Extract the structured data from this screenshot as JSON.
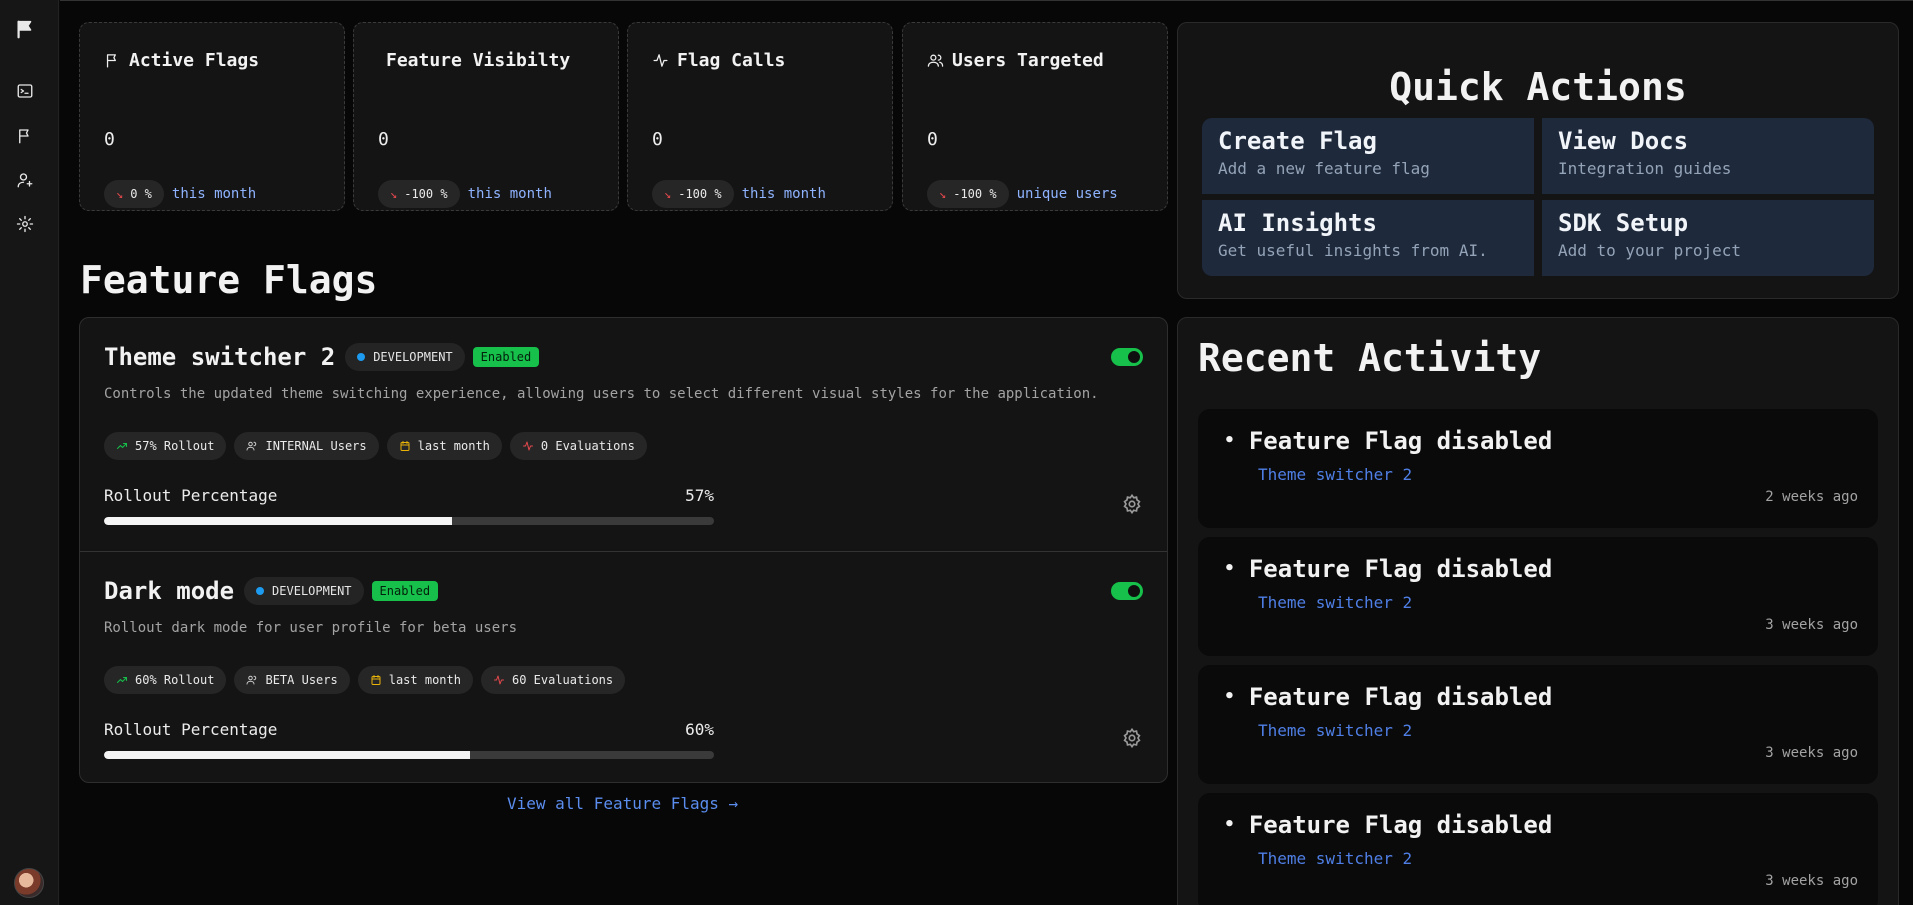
{
  "stats": [
    {
      "title": "Active Flags",
      "icon": "flag-icon",
      "value": "0",
      "change": "0 %",
      "sub": "this month"
    },
    {
      "title": "Feature Visibilty",
      "icon": "",
      "value": "0",
      "change": "-100 %",
      "sub": "this month"
    },
    {
      "title": "Flag Calls",
      "icon": "activity-icon",
      "value": "0",
      "change": "-100 %",
      "sub": "this month"
    },
    {
      "title": "Users Targeted",
      "icon": "users-icon",
      "value": "0",
      "change": "-100 %",
      "sub": "unique users"
    }
  ],
  "quick_actions": {
    "title": "Quick Actions",
    "items": [
      {
        "title": "Create Flag",
        "desc": "Add a new feature flag"
      },
      {
        "title": "View Docs",
        "desc": "Integration guides"
      },
      {
        "title": "AI Insights",
        "desc": "Get useful insights from AI."
      },
      {
        "title": "SDK Setup",
        "desc": "Add to your project"
      }
    ]
  },
  "feature_flags": {
    "title": "Feature Flags",
    "view_all": "View all Feature Flags →",
    "rollout_label": "Rollout Percentage",
    "items": [
      {
        "name": "Theme switcher 2",
        "env": "DEVELOPMENT",
        "status": "Enabled",
        "enabled": true,
        "description": "Controls the updated theme switching experience, allowing users to select different visual styles for the application.",
        "rollout_pill": "57% Rollout",
        "users_pill": "INTERNAL Users",
        "date_pill": "last month",
        "evals_pill": "0 Evaluations",
        "rollout": 57,
        "rollout_text": "57%"
      },
      {
        "name": "Dark mode",
        "env": "DEVELOPMENT",
        "status": "Enabled",
        "enabled": true,
        "description": "Rollout dark mode for user profile for beta users",
        "rollout_pill": "60% Rollout",
        "users_pill": "BETA Users",
        "date_pill": "last month",
        "evals_pill": "60 Evaluations",
        "rollout": 60,
        "rollout_text": "60%"
      }
    ]
  },
  "recent_activity": {
    "title": "Recent Activity",
    "items": [
      {
        "title": "Feature Flag disabled",
        "link": "Theme switcher 2",
        "time": "2 weeks ago"
      },
      {
        "title": "Feature Flag disabled",
        "link": "Theme switcher 2",
        "time": "3 weeks ago"
      },
      {
        "title": "Feature Flag disabled",
        "link": "Theme switcher 2",
        "time": "3 weeks ago"
      },
      {
        "title": "Feature Flag disabled",
        "link": "Theme switcher 2",
        "time": "3 weeks ago"
      }
    ]
  },
  "sidebar": {
    "icons": [
      "logo-flag-icon",
      "terminal-icon",
      "flag-icon",
      "user-plus-icon",
      "gear-icon"
    ]
  },
  "colors": {
    "accent_green": "#16c04a",
    "link_blue": "#4f7fe6",
    "trend_red": "#e5484d",
    "quick_action_bg": "#1e293b"
  }
}
